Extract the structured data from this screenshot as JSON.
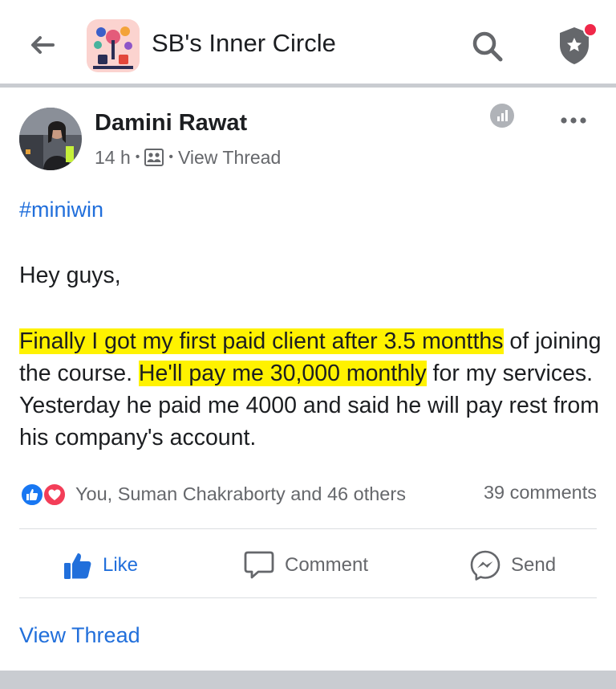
{
  "header": {
    "group_title": "SB's Inner Circle",
    "icons": [
      "back-arrow-icon",
      "search-icon",
      "admin-shield-icon"
    ],
    "notification_dot_color": "#f02849"
  },
  "post": {
    "author": "Damini Rawat",
    "time": "14 h",
    "separator": "•",
    "thread_link": "View Thread",
    "hashtag": "#miniwin",
    "greeting": "Hey guys,",
    "highlight_1": "Finally I got my first paid client after 3.5 montths",
    "text_1": " of joining the course. ",
    "highlight_2": "He'll pay me 30,000 monthly",
    "text_2": " for my services. Yesterday he paid me 4000 and said he will pay rest from his company's account.",
    "highlight_color": "#fff200"
  },
  "engagement": {
    "reactions_text": "You, Suman Chakraborty and 46 others",
    "comments_text": "39 comments"
  },
  "actions": {
    "like": "Like",
    "comment": "Comment",
    "send": "Send"
  },
  "footer": {
    "view_thread": "View Thread"
  },
  "colors": {
    "link_blue": "#216fdb",
    "meta_gray": "#65676b",
    "divider": "#dadde1"
  }
}
